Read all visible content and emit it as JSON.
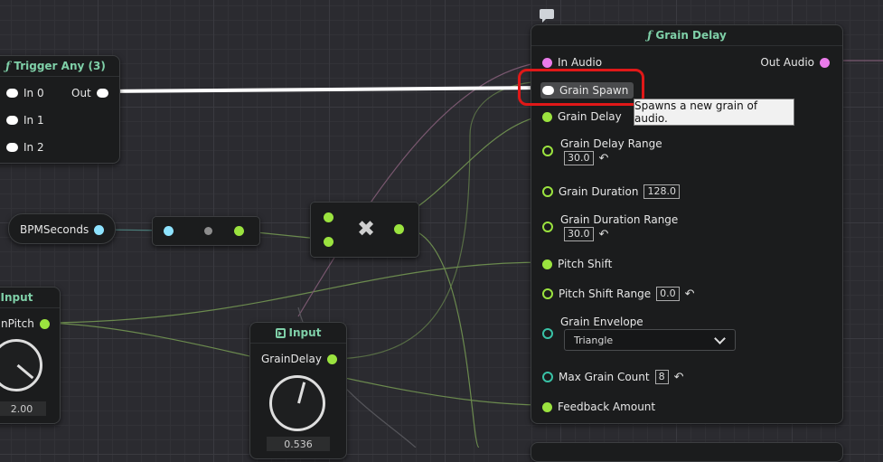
{
  "trigger_any": {
    "title": "Trigger Any (3)",
    "inputs": [
      "In 0",
      "In 1",
      "In 2"
    ],
    "output": "Out"
  },
  "bpm": {
    "label": "BPMSeconds"
  },
  "multiply": {
    "symbol": "✖"
  },
  "input_pitch": {
    "title": "Input",
    "pin": "nPitch",
    "value": "2.00"
  },
  "input_grain_delay": {
    "title": "Input",
    "pin": "GrainDelay",
    "value": "0.536"
  },
  "grain_delay_node": {
    "title": "Grain Delay",
    "in_audio": "In Audio",
    "out_audio": "Out Audio",
    "grain_spawn": "Grain Spawn",
    "grain_delay": "Grain Delay",
    "grain_delay_range": {
      "label": "Grain Delay Range",
      "value": "30.0"
    },
    "grain_duration": {
      "label": "Grain Duration",
      "value": "128.0"
    },
    "grain_duration_range": {
      "label": "Grain Duration Range",
      "value": "30.0"
    },
    "pitch_shift": "Pitch Shift",
    "pitch_shift_range": {
      "label": "Pitch Shift Range",
      "value": "0.0"
    },
    "grain_envelope": {
      "label": "Grain Envelope",
      "selected": "Triangle"
    },
    "max_grain_count": {
      "label": "Max Grain Count",
      "value": "8"
    },
    "feedback_amount": "Feedback Amount"
  },
  "tooltip": "Spawns a new grain of audio.",
  "icons": {
    "function": "ƒ",
    "reset": "↶"
  }
}
